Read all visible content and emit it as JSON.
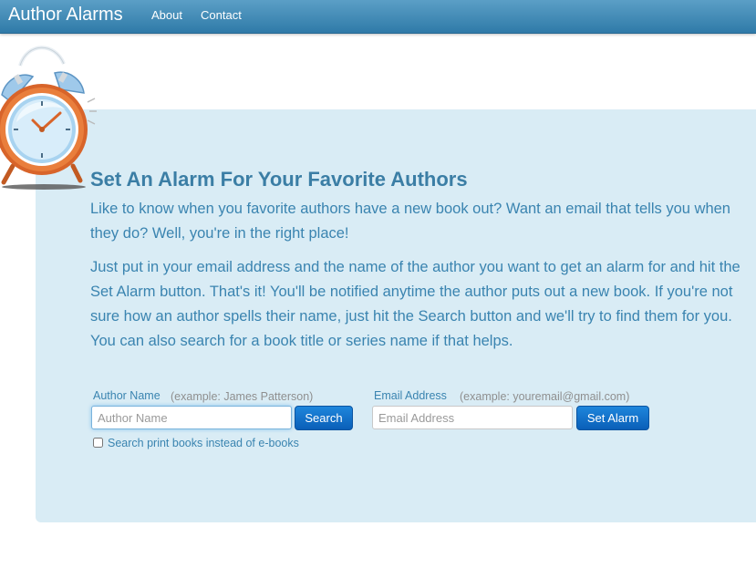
{
  "navbar": {
    "brand": "Author Alarms",
    "links": [
      "About",
      "Contact"
    ]
  },
  "hero": {
    "title": "Set An Alarm For Your Favorite Authors",
    "paragraph1": "Like to know when you favorite authors have a new book out? Want an email that tells you when they do? Well, you're in the right place!",
    "paragraph2": "Just put in your email address and the name of the author you want to get an alarm for and hit the Set Alarm button. That's it! You'll be notified anytime the author puts out a new book. If you're not sure how an author spells their name, just hit the Search button and we'll try to find them for you. You can also search for a book title or series name if that helps."
  },
  "author_form": {
    "label": "Author Name",
    "hint": "(example: James Patterson)",
    "placeholder": "Author Name",
    "value": "",
    "search_button": "Search",
    "checkbox_label": "Search print books instead of e-books",
    "checkbox_checked": false
  },
  "email_form": {
    "label": "Email Address",
    "hint": "(example: youremail@gmail.com)",
    "placeholder": "Email Address",
    "value": "",
    "set_alarm_button": "Set Alarm"
  },
  "icons": {
    "logo": "alarm-clock-icon"
  },
  "colors": {
    "navbar": "#3a8ab8",
    "hero_background": "#d9ecf5",
    "text_blue": "#3a84b0",
    "button_blue": "#0f6fd0"
  }
}
